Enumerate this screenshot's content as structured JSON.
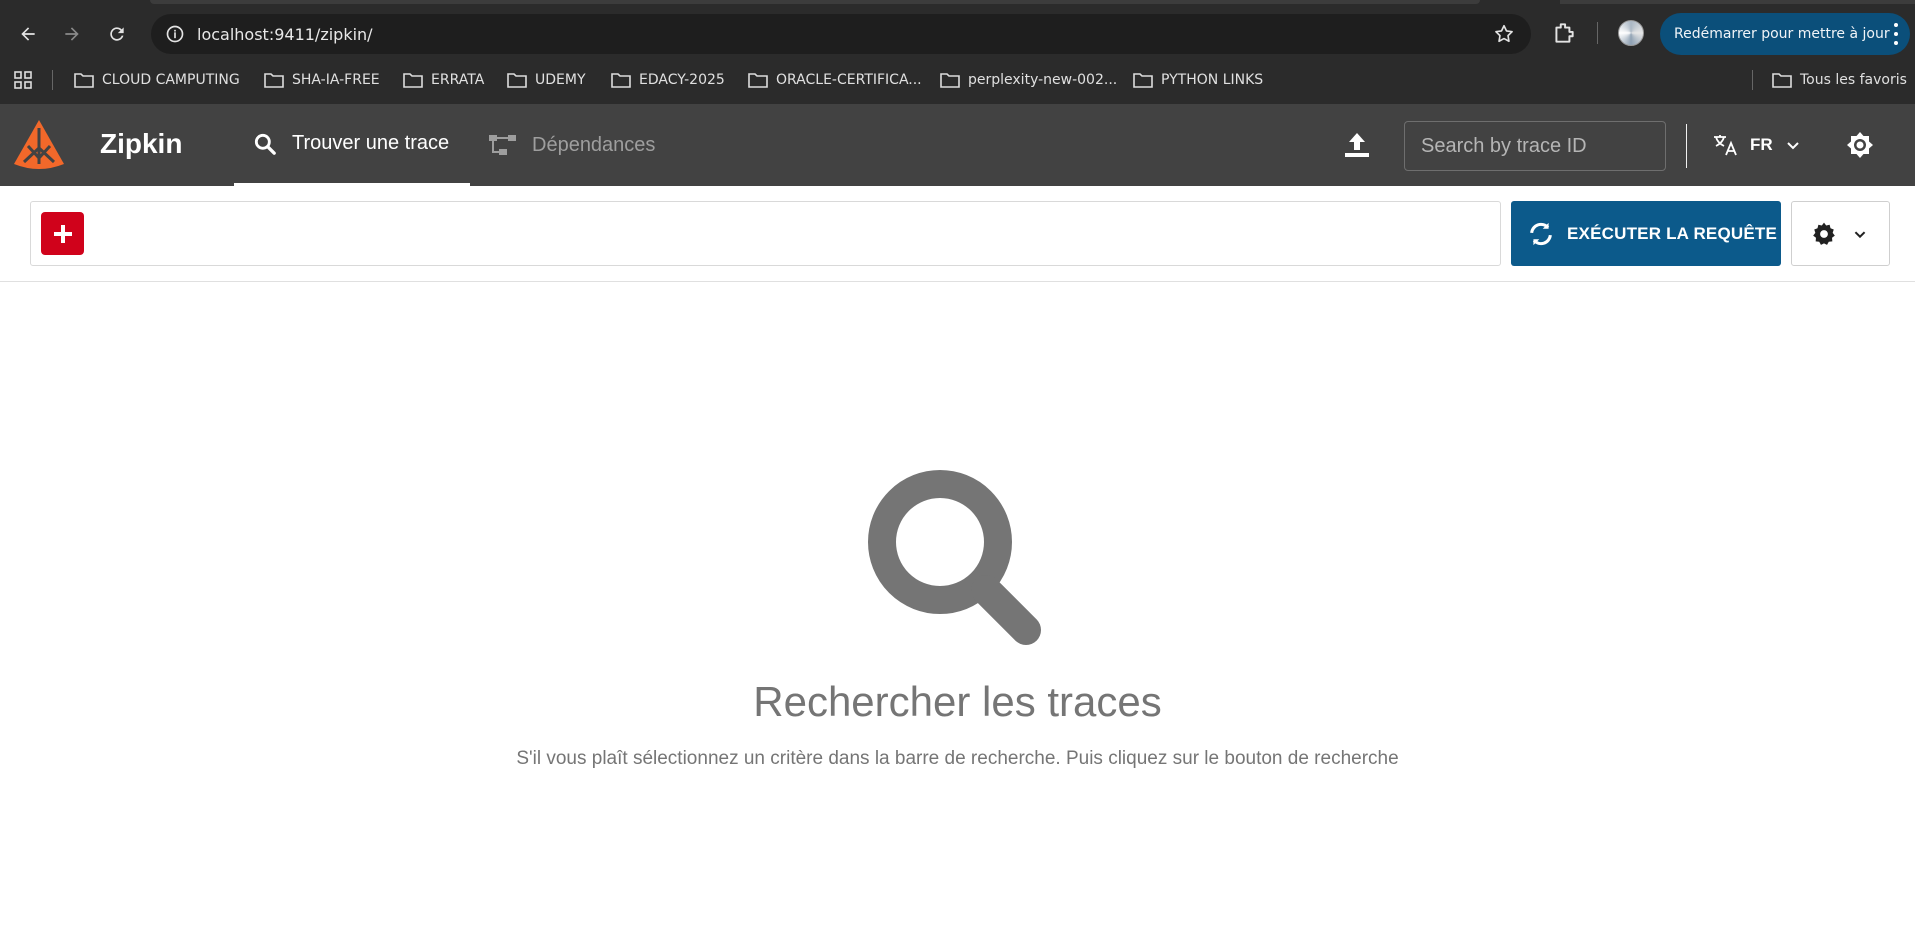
{
  "browser": {
    "url": "localhost:9411/zipkin/",
    "restart_label": "Redémarrer pour mettre à jour",
    "bookmarks": [
      "CLOUD CAMPUTING",
      "SHA-IA-FREE",
      "ERRATA",
      "UDEMY",
      "EDACY-2025",
      "ORACLE-CERTIFICA...",
      "perplexity-new-002...",
      "PYTHON LINKS"
    ],
    "all_bookmarks": "Tous les favoris"
  },
  "header": {
    "brand": "Zipkin",
    "tab_find": "Trouver une trace",
    "tab_dependencies": "Dépendances",
    "trace_search_placeholder": "Search by trace ID",
    "language": "FR"
  },
  "query": {
    "run_label": "EXÉCUTER LA REQUÊTE"
  },
  "empty_state": {
    "title": "Rechercher les traces",
    "description": "S'il vous plaît sélectionnez un critère dans la barre de recherche. Puis cliquez sur le bouton de recherche"
  },
  "colors": {
    "header_bg": "#424242",
    "run_button": "#0c5a8b",
    "add_button": "#d0021b",
    "logo": "#f2682a"
  }
}
